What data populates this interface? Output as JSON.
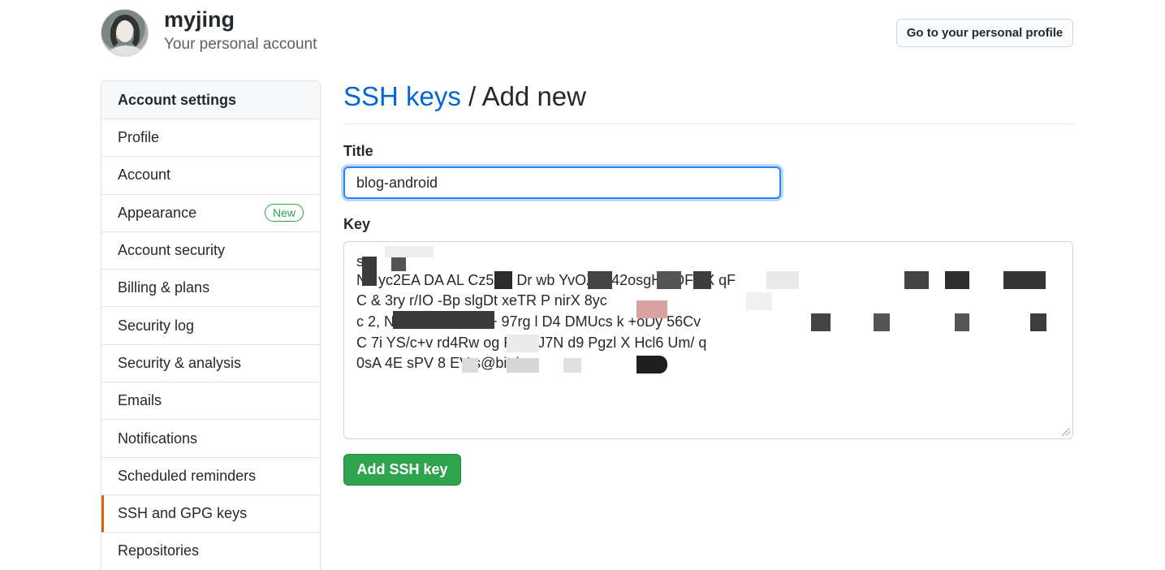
{
  "user": {
    "username": "myjing",
    "account_type": "Your personal account",
    "profile_button": "Go to your personal profile"
  },
  "sidebar": {
    "header": "Account settings",
    "items": [
      {
        "label": "Profile"
      },
      {
        "label": "Account"
      },
      {
        "label": "Appearance",
        "badge": "New"
      },
      {
        "label": "Account security"
      },
      {
        "label": "Billing & plans"
      },
      {
        "label": "Security log"
      },
      {
        "label": "Security & analysis"
      },
      {
        "label": "Emails"
      },
      {
        "label": "Notifications"
      },
      {
        "label": "Scheduled reminders"
      },
      {
        "label": "SSH and GPG keys",
        "active": true
      },
      {
        "label": "Repositories"
      }
    ]
  },
  "main": {
    "breadcrumb_link": "SSH keys",
    "breadcrumb_separator": " / ",
    "breadcrumb_current": "Add new",
    "title_label": "Title",
    "title_value": "blog-android",
    "key_label": "Key",
    "key_lines": [
      "s",
      "Nz   yc2EA    DA  AL        Cz5dR    Dr    wb   YvOZ    M42osgH    5DFc     X         qF",
      "C   &             3ry        r/IO   -Bp   slgDt            xeTR    P    nirX         8yc",
      "c  2,         NoHiS   mO  v  zm+              97rg  l    D4          DMUcs      k    +oDy    56Cv",
      "C   7i              YS/c+v    rd4Rw           og    F     eiEJ7N    d9    Pgzl          X    Hcl6          Um/          q",
      "0sA   4E    sPV      8                  EV      s@bitri        o"
    ],
    "submit_label": "Add SSH key"
  },
  "colors": {
    "link": "#0366d6",
    "primary_button": "#2ea44f",
    "badge_green": "#28a745",
    "active_indicator": "#e36209",
    "focus_ring": "#2188ff"
  }
}
